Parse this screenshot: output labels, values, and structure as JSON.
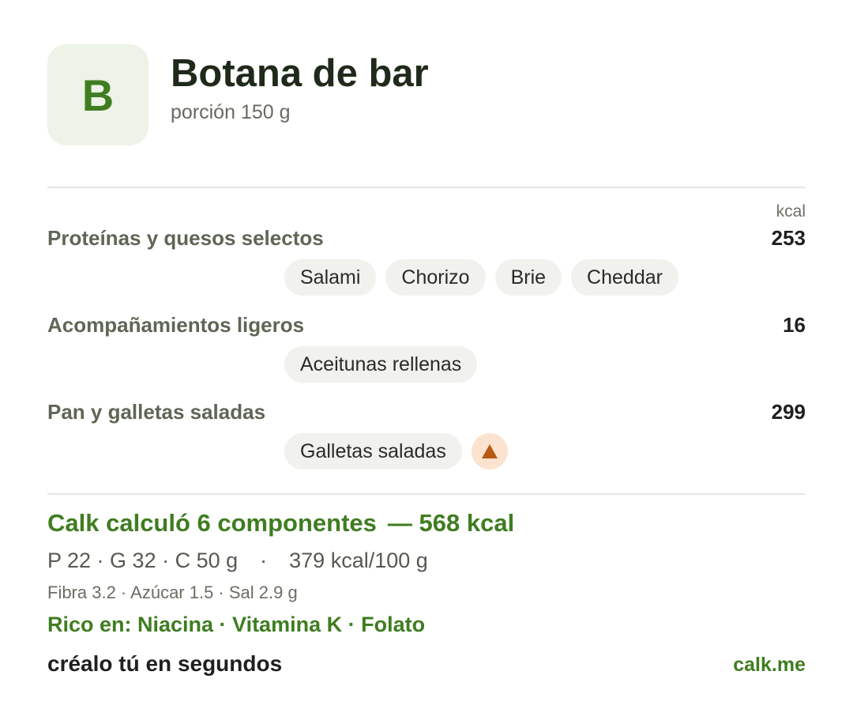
{
  "header": {
    "grade": "B",
    "title": "Botana de bar",
    "portion": "porción 150 g"
  },
  "unit_label": "kcal",
  "groups": [
    {
      "name": "Proteínas y quesos selectos",
      "kcal": "253",
      "items": [
        "Salami",
        "Chorizo",
        "Brie",
        "Cheddar"
      ]
    },
    {
      "name": "Acompañamientos ligeros",
      "kcal": "16",
      "items": [
        "Aceitunas rellenas"
      ]
    },
    {
      "name": "Pan y galletas saladas",
      "kcal": "299",
      "items": [
        "Galletas saladas"
      ],
      "warning_icon": "warning-triangle-icon"
    }
  ],
  "summary": {
    "title": "Calk calculó 6 componentes",
    "total": "— 568 kcal",
    "macros": "P 22 · G 32 · C 50 g",
    "separator": "·",
    "density": "379 kcal/100 g",
    "micros": "Fibra 3.2 · Azúcar 1.5 · Sal 2.9 g",
    "rich_in": "Rico en: Niacina · Vitamina K · Folato"
  },
  "footer": {
    "cta": "créalo tú en segundos",
    "link": "calk.me"
  },
  "colors": {
    "accent": "#3f7d20",
    "grade_bg": "#edf3e6",
    "chip_bg": "#f1f1ed",
    "warning_bg": "#fbe3cf",
    "warning_fg": "#b85a14"
  }
}
